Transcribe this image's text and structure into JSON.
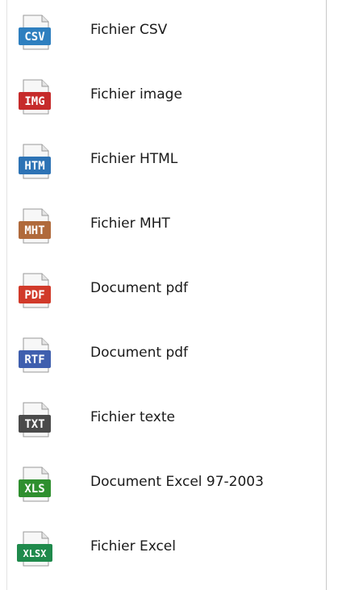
{
  "menu": {
    "items": [
      {
        "label": "Fichier CSV",
        "badge": "CSV",
        "icon": "csv-file-icon",
        "color": "#2e7fbf"
      },
      {
        "label": "Fichier image",
        "badge": "IMG",
        "icon": "image-file-icon",
        "color": "#c62b2b"
      },
      {
        "label": "Fichier HTML",
        "badge": "HTM",
        "icon": "html-file-icon",
        "color": "#2d73b5"
      },
      {
        "label": "Fichier MHT",
        "badge": "MHT",
        "icon": "mht-file-icon",
        "color": "#b06a3b"
      },
      {
        "label": "Document pdf",
        "badge": "PDF",
        "icon": "pdf-file-icon",
        "color": "#d13a2a"
      },
      {
        "label": "Document pdf",
        "badge": "RTF",
        "icon": "rtf-file-icon",
        "color": "#3f5fae"
      },
      {
        "label": "Fichier texte",
        "badge": "TXT",
        "icon": "txt-file-icon",
        "color": "#4a4a4a"
      },
      {
        "label": "Document Excel 97-2003",
        "badge": "XLS",
        "icon": "xls-file-icon",
        "color": "#2f8f2f"
      },
      {
        "label": "Fichier Excel",
        "badge": "XLSX",
        "icon": "xlsx-file-icon",
        "color": "#1f8a4c"
      }
    ]
  }
}
